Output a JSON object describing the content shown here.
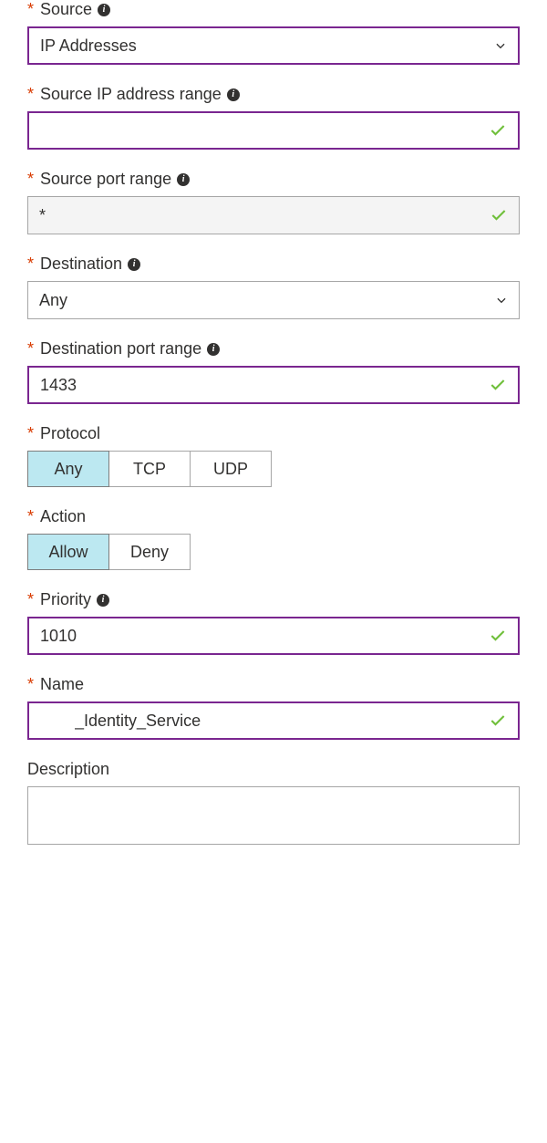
{
  "source": {
    "label": "Source",
    "value": "IP Addresses",
    "required": true,
    "info": true,
    "style": "purple"
  },
  "source_ip_range": {
    "label": "Source IP address range",
    "value": "",
    "required": true,
    "info": true,
    "style": "purple",
    "valid": true
  },
  "source_port_range": {
    "label": "Source port range",
    "value": "*",
    "required": true,
    "info": true,
    "style": "grey",
    "valid": true
  },
  "destination": {
    "label": "Destination",
    "value": "Any",
    "required": true,
    "info": true,
    "style": "grey"
  },
  "destination_port_range": {
    "label": "Destination port range",
    "value": "1433",
    "required": true,
    "info": true,
    "style": "purple",
    "valid": true
  },
  "protocol": {
    "label": "Protocol",
    "required": true,
    "options": {
      "any": "Any",
      "tcp": "TCP",
      "udp": "UDP"
    },
    "selected": "any"
  },
  "action": {
    "label": "Action",
    "required": true,
    "options": {
      "allow": "Allow",
      "deny": "Deny"
    },
    "selected": "allow"
  },
  "priority": {
    "label": "Priority",
    "value": "1010",
    "required": true,
    "info": true,
    "style": "purple",
    "valid": true
  },
  "name": {
    "label": "Name",
    "value": "_Identity_Service",
    "required": true,
    "style": "purple",
    "valid": true
  },
  "description": {
    "label": "Description",
    "value": ""
  }
}
